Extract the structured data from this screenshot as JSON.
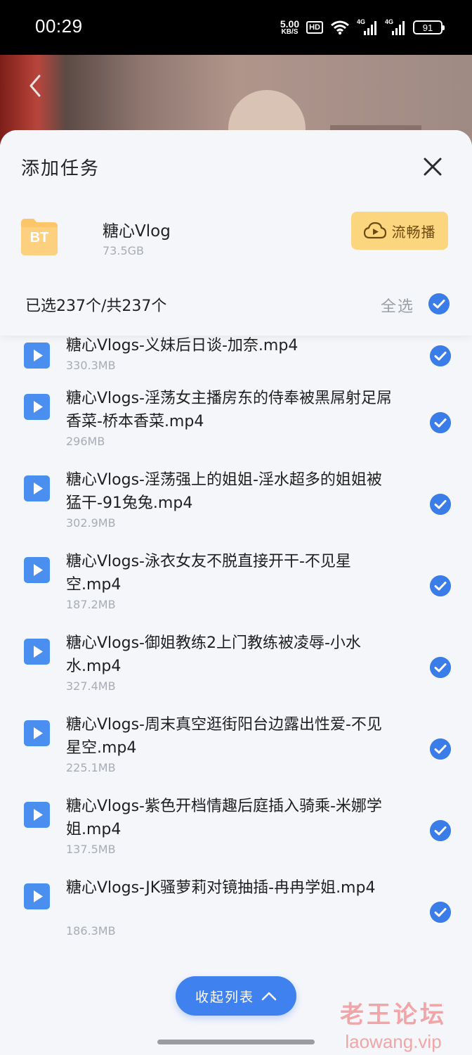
{
  "status_bar": {
    "time": "00:29",
    "net_speed_value": "5.00",
    "net_speed_unit": "KB/S",
    "hd_badge": "HD",
    "signal1_label": "4G",
    "signal2_label": "4G",
    "battery": "91"
  },
  "sheet": {
    "title": "添加任务",
    "torrent": {
      "icon_label": "BT",
      "name": "糖心Vlog",
      "size": "73.5GB"
    },
    "play_button_label": "流畅播",
    "selected_count": "已选237个/共237个",
    "select_all_label": "全选",
    "collapse_button_label": "收起列表",
    "files": [
      {
        "name": "糖心Vlogs-义妹后日谈-加奈.mp4",
        "size": "330.3MB",
        "checked": true
      },
      {
        "name": "糖心Vlogs-淫荡女主播房东的侍奉被黑屌射足屌香菜-桥本香菜.mp4",
        "size": "296MB",
        "checked": true
      },
      {
        "name": "糖心Vlogs-淫荡强上的姐姐-淫水超多的姐姐被猛干-91兔兔.mp4",
        "size": "302.9MB",
        "checked": true
      },
      {
        "name": "糖心Vlogs-泳衣女友不脱直接开干-不见星空.mp4",
        "size": "187.2MB",
        "checked": true
      },
      {
        "name": "糖心Vlogs-御姐教练2上门教练被凌辱-小水水.mp4",
        "size": "327.4MB",
        "checked": true
      },
      {
        "name": "糖心Vlogs-周末真空逛街阳台边露出性爱-不见星空.mp4",
        "size": "225.1MB",
        "checked": true
      },
      {
        "name": "糖心Vlogs-紫色开档情趣后庭插入骑乘-米娜学姐.mp4",
        "size": "137.5MB",
        "checked": true
      },
      {
        "name": "糖心Vlogs-JK骚萝莉对镜抽插-冉冉学姐.mp4",
        "size": "186.3MB",
        "checked": true
      }
    ]
  },
  "watermark": {
    "cn": "老王论坛",
    "en": "laowang.vip"
  },
  "colors": {
    "accent": "#3f81ee",
    "check": "#3b7de8",
    "play_button_bg": "#fcd67f",
    "bt_folder": "#fbc56a",
    "file_icon": "#4a8ef0",
    "sheet_bg": "#f5f6fa"
  }
}
